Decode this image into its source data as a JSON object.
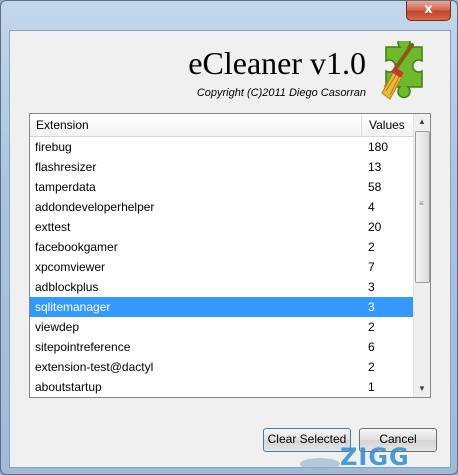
{
  "window": {
    "close_label": "x"
  },
  "header": {
    "title": "eCleaner v1.0",
    "copyright": "Copyright (C)2011 Diego Casorran"
  },
  "list": {
    "columns": [
      "Extension",
      "Values"
    ],
    "rows": [
      {
        "extension": "firebug",
        "value": "180"
      },
      {
        "extension": "flashresizer",
        "value": "13"
      },
      {
        "extension": "tamperdata",
        "value": "58"
      },
      {
        "extension": "addondeveloperhelper",
        "value": "4"
      },
      {
        "extension": "exttest",
        "value": "20"
      },
      {
        "extension": "facebookgamer",
        "value": "2"
      },
      {
        "extension": "xpcomviewer",
        "value": "7"
      },
      {
        "extension": "adblockplus",
        "value": "3"
      },
      {
        "extension": "sqlitemanager",
        "value": "3"
      },
      {
        "extension": "viewdep",
        "value": "2"
      },
      {
        "extension": "sitepointreference",
        "value": "6"
      },
      {
        "extension": "extension-test@dactyl",
        "value": "2"
      },
      {
        "extension": "aboutstartup",
        "value": "1"
      }
    ],
    "selected_index": 8
  },
  "buttons": {
    "clear_selected": "Clear Selected",
    "cancel": "Cancel"
  },
  "watermark": {
    "text": "ZIGG"
  },
  "colors": {
    "selection": "#3399ff",
    "accent": "#2b8fd6"
  }
}
